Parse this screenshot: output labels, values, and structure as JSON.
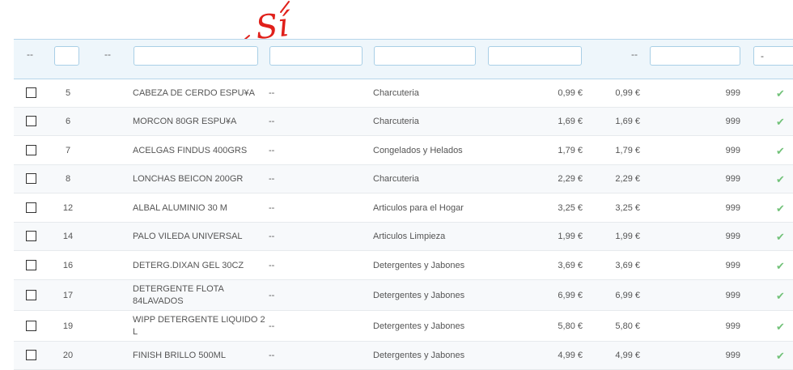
{
  "annotation": {
    "text": "Sí"
  },
  "filters": {
    "dash": "--",
    "select": "-"
  },
  "rows": [
    {
      "id": "5",
      "name": "CABEZA DE CERDO ESPU¥A",
      "ref": "--",
      "category": "Charcuteria",
      "price": "0,99 €",
      "price_final": "0,99 €",
      "qty": "999"
    },
    {
      "id": "6",
      "name": "MORCON 80GR ESPU¥A",
      "ref": "--",
      "category": "Charcuteria",
      "price": "1,69 €",
      "price_final": "1,69 €",
      "qty": "999"
    },
    {
      "id": "7",
      "name": "ACELGAS FINDUS 400GRS",
      "ref": "--",
      "category": "Congelados y Helados",
      "price": "1,79 €",
      "price_final": "1,79 €",
      "qty": "999"
    },
    {
      "id": "8",
      "name": "LONCHAS BEICON 200GR",
      "ref": "--",
      "category": "Charcuteria",
      "price": "2,29 €",
      "price_final": "2,29 €",
      "qty": "999"
    },
    {
      "id": "12",
      "name": "ALBAL ALUMINIO 30 M",
      "ref": "--",
      "category": "Articulos para el Hogar",
      "price": "3,25 €",
      "price_final": "3,25 €",
      "qty": "999"
    },
    {
      "id": "14",
      "name": "PALO VILEDA UNIVERSAL",
      "ref": "--",
      "category": "Articulos Limpieza",
      "price": "1,99 €",
      "price_final": "1,99 €",
      "qty": "999"
    },
    {
      "id": "16",
      "name": "DETERG.DIXAN GEL 30CZ",
      "ref": "--",
      "category": "Detergentes y Jabones",
      "price": "3,69 €",
      "price_final": "3,69 €",
      "qty": "999"
    },
    {
      "id": "17",
      "name": "DETERGENTE FLOTA 84LAVADOS",
      "ref": "--",
      "category": "Detergentes y Jabones",
      "price": "6,99 €",
      "price_final": "6,99 €",
      "qty": "999"
    },
    {
      "id": "19",
      "name": "WIPP DETERGENTE LIQUIDO 2 L",
      "ref": "--",
      "category": "Detergentes y Jabones",
      "price": "5,80 €",
      "price_final": "5,80 €",
      "qty": "999"
    },
    {
      "id": "20",
      "name": "FINISH BRILLO 500ML",
      "ref": "--",
      "category": "Detergentes y Jabones",
      "price": "4,99 €",
      "price_final": "4,99 €",
      "qty": "999"
    }
  ],
  "status_icon": "check-icon",
  "status_glyph": "✔",
  "colors": {
    "accent_border": "#a9cfe6",
    "header_bg": "#eef6fb",
    "status_green": "#72c279",
    "annotation_red": "#e0201a"
  }
}
